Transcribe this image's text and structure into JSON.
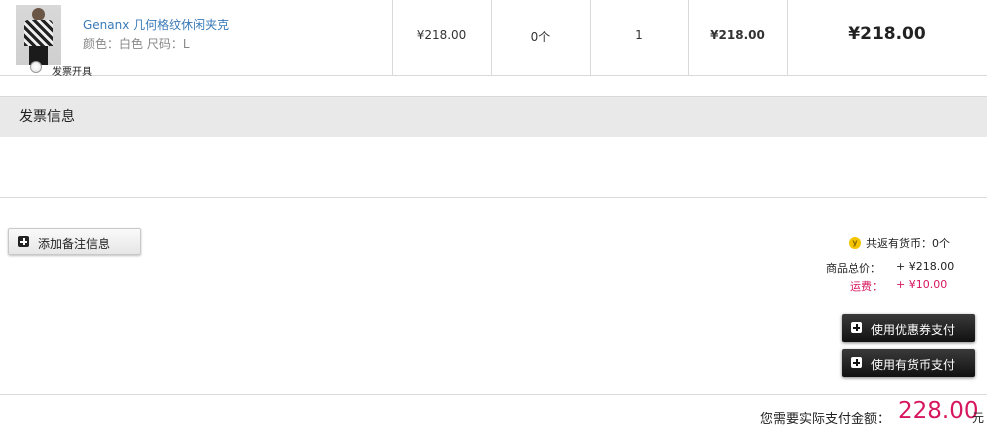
{
  "product": {
    "name": "Genanx 几何格纹休闲夹克",
    "attrs": "颜色：白色 尺码：L",
    "unit_price": "¥218.00",
    "coins": "0个",
    "quantity": "1",
    "subtotal": "¥218.00",
    "total": "¥218.00"
  },
  "invoice": {
    "title": "发票信息",
    "option_label": "发票开具"
  },
  "note_button": {
    "icon": "plus-square-icon",
    "label": "添加备注信息"
  },
  "summary": {
    "coin_icon_glyph": "y",
    "coin_text": "共返有货币：0个",
    "goods_total_label": "商品总价：",
    "goods_total_value": "+ ¥218.00",
    "shipping_label": "运费：",
    "shipping_value": "+ ¥10.00",
    "shipping_color": "#d6175f"
  },
  "actions": {
    "coupon_label": "使用优惠券支付",
    "coin_pay_label": "使用有货币支付"
  },
  "payment": {
    "label": "您需要实际支付金额：",
    "amount": "228.00",
    "unit": "元",
    "amount_color": "#d6175f"
  }
}
